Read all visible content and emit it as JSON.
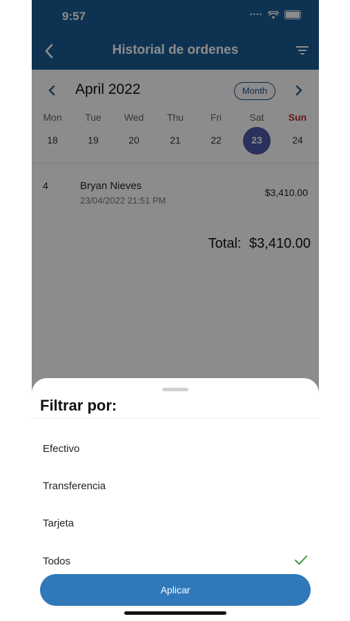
{
  "status_bar": {
    "time": "9:57",
    "signal": "••••"
  },
  "nav": {
    "title": "Historial de ordenes",
    "back_icon": "chevron-left-icon",
    "filter_icon": "filter-icon"
  },
  "calendar": {
    "month": "April 2022",
    "mode": "Month",
    "weekdays": [
      "Mon",
      "Tue",
      "Wed",
      "Thu",
      "Fri",
      "Sat",
      "Sun"
    ],
    "dates": [
      "18",
      "19",
      "20",
      "21",
      "22",
      "23",
      "24"
    ],
    "selected_date": "23"
  },
  "orders": [
    {
      "number": "4",
      "customer": "Bryan Nieves",
      "datetime": "23/04/2022 21:51 PM",
      "amount": "$3,410.00"
    }
  ],
  "total": {
    "label": "Total:",
    "amount": "$3,410.00"
  },
  "filter_sheet": {
    "title": "Filtrar por:",
    "options": [
      {
        "label": "Efectivo",
        "selected": false
      },
      {
        "label": "Transferencia",
        "selected": false
      },
      {
        "label": "Tarjeta",
        "selected": false
      },
      {
        "label": "Todos",
        "selected": true
      }
    ],
    "apply_label": "Aplicar"
  },
  "colors": {
    "primary": "#1b5e95",
    "selected_date": "#4d5aa8",
    "sunday": "#c62828",
    "check": "#3a9a3a",
    "apply_button": "#2f79ba"
  }
}
